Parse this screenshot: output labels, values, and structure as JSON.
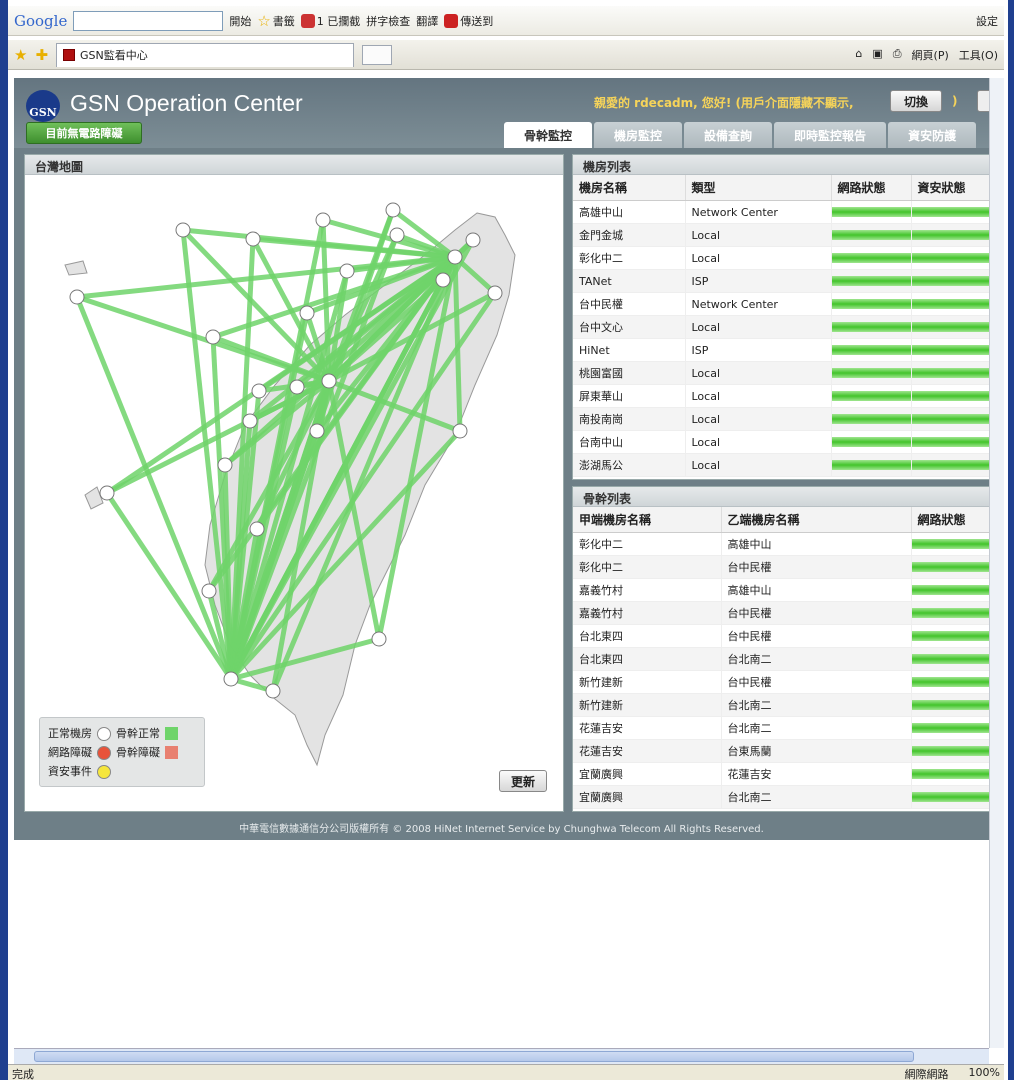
{
  "google_toolbar": {
    "logo": "Google",
    "start_label": "開始",
    "bookmarks_label": "書籤",
    "blocked_label": "1 已攔截",
    "spell_label": "拼字檢查",
    "translate_label": "翻譯",
    "send_label": "傳送到",
    "settings_label": "設定"
  },
  "browser_tabs": {
    "tab_title": "GSN監看中心",
    "page_menu": "網頁(P)",
    "tools_menu": "工具(O)"
  },
  "app": {
    "title": "GSN Operation Center",
    "logo_text": "GSN",
    "greeting": "親愛的 rdecadm, 您好! (用戶介面隱藏不顯示,",
    "switch_label": "切換",
    "paren": ")",
    "alert_button": "目前無電路障礙",
    "nav_tabs": [
      {
        "label": "骨幹監控",
        "active": true
      },
      {
        "label": "機房監控"
      },
      {
        "label": "設備查詢"
      },
      {
        "label": "即時監控報告"
      },
      {
        "label": "資安防護"
      }
    ]
  },
  "map_panel": {
    "title": "台灣地圖",
    "refresh_label": "更新",
    "legend": {
      "normal_room": "正常機房",
      "trunk_normal": "骨幹正常",
      "net_fault": "網路障礙",
      "trunk_fault": "骨幹障礙",
      "security_event": "資安事件"
    },
    "colors": {
      "normal": "#ffffff",
      "fault": "#e8533a",
      "security": "#f5e63c",
      "trunk_ok": "#6fd46a",
      "trunk_fault": "#e88070"
    }
  },
  "rooms_panel": {
    "title": "機房列表",
    "headers": [
      "機房名稱",
      "類型",
      "網路狀態",
      "資安狀態"
    ],
    "rows": [
      [
        "高雄中山",
        "Network Center"
      ],
      [
        "金門金城",
        "Local"
      ],
      [
        "彰化中二",
        "Local"
      ],
      [
        "TANet",
        "ISP"
      ],
      [
        "台中民權",
        "Network Center"
      ],
      [
        "台中文心",
        "Local"
      ],
      [
        "HiNet",
        "ISP"
      ],
      [
        "桃園富國",
        "Local"
      ],
      [
        "屏東華山",
        "Local"
      ],
      [
        "南投南崗",
        "Local"
      ],
      [
        "台南中山",
        "Local"
      ],
      [
        "澎湖馬公",
        "Local"
      ]
    ]
  },
  "trunks_panel": {
    "title": "骨幹列表",
    "headers": [
      "甲端機房名稱",
      "乙端機房名稱",
      "網路狀態"
    ],
    "rows": [
      [
        "彰化中二",
        "高雄中山"
      ],
      [
        "彰化中二",
        "台中民權"
      ],
      [
        "嘉義竹村",
        "高雄中山"
      ],
      [
        "嘉義竹村",
        "台中民權"
      ],
      [
        "台北東四",
        "台中民權"
      ],
      [
        "台北東四",
        "台北南二"
      ],
      [
        "新竹建新",
        "台中民權"
      ],
      [
        "新竹建新",
        "台北南二"
      ],
      [
        "花蓮吉安",
        "台北南二"
      ],
      [
        "花蓮吉安",
        "台東馬蘭"
      ],
      [
        "宜蘭廣興",
        "花蓮吉安"
      ],
      [
        "宜蘭廣興",
        "台北南二"
      ]
    ]
  },
  "footer": "中華電信數據通信分公司版權所有 © 2008 HiNet Internet Service by Chunghwa Telecom All Rights Reserved.",
  "statusbar": {
    "left": "完成",
    "zone": "網際網路",
    "zoom": "100%"
  }
}
